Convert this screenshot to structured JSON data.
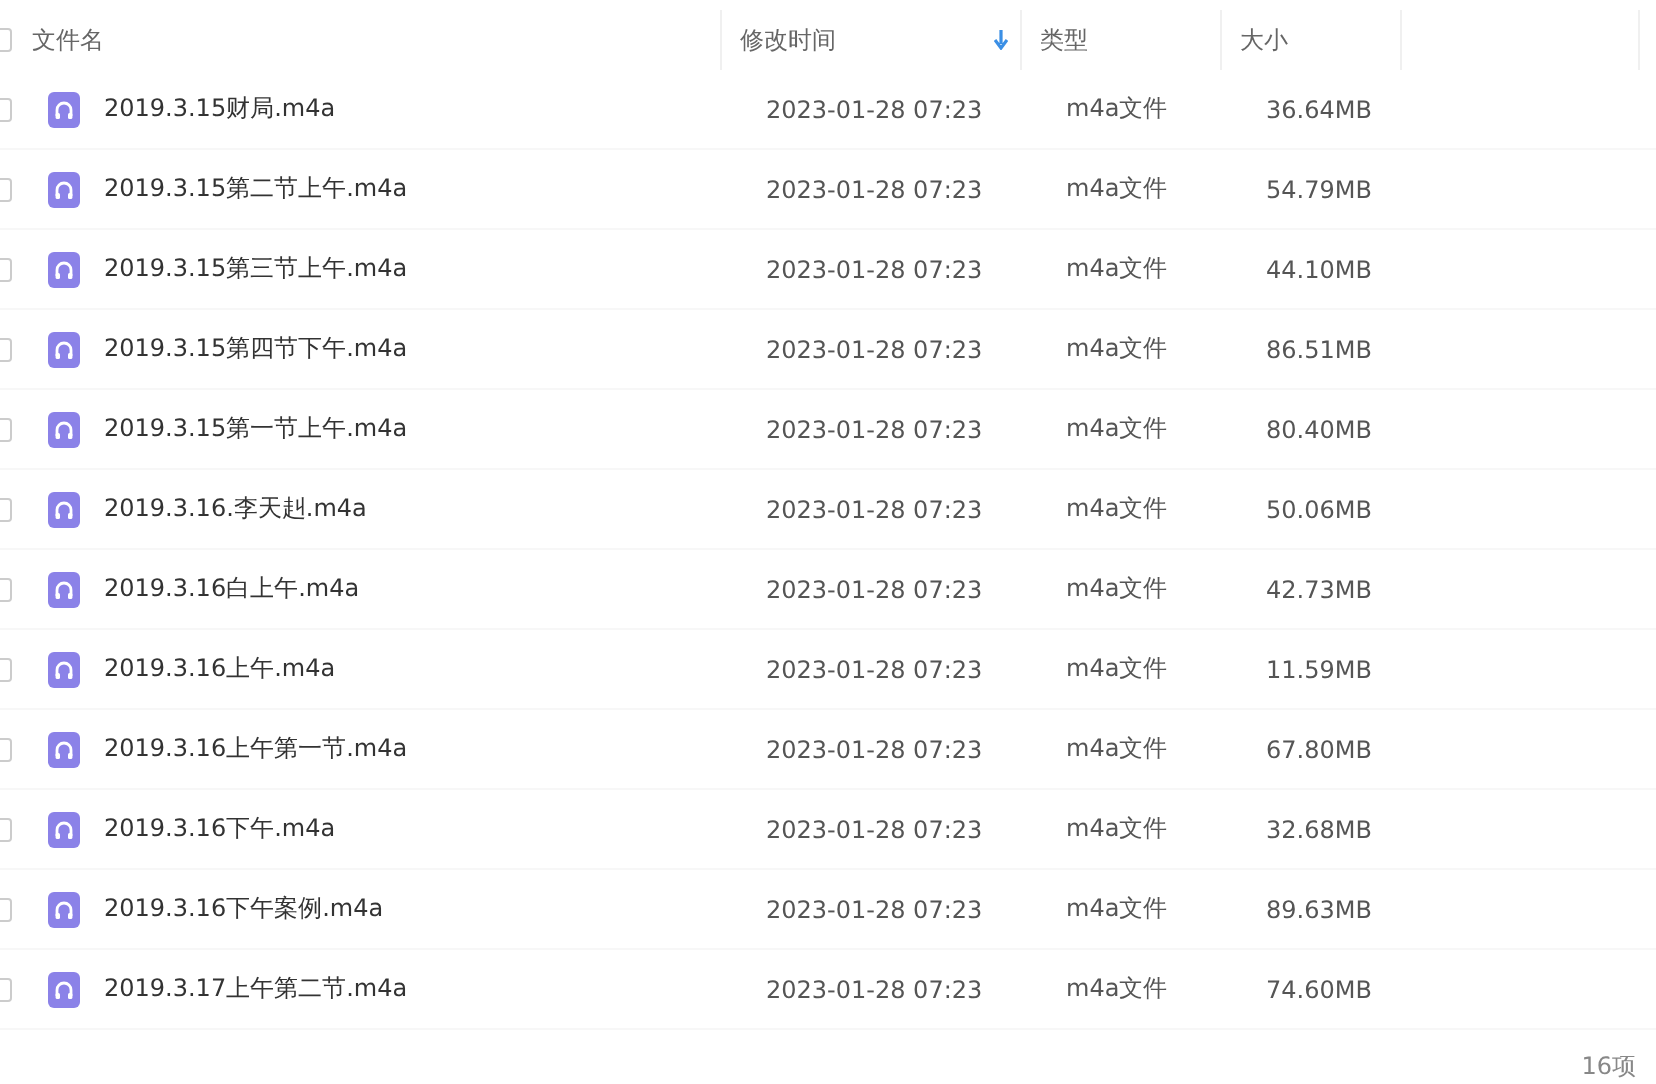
{
  "select_all_checked": false,
  "columns": [
    {
      "label": "文件名",
      "sorted": false
    },
    {
      "label": "修改时间",
      "sorted": true
    },
    {
      "label": "类型",
      "sorted": false
    },
    {
      "label": "大小",
      "sorted": false
    }
  ],
  "rows": [
    {
      "checked": false,
      "name": "2019.3.15财局.m4a",
      "modified": "2023-01-28 07:23",
      "type": "m4a文件",
      "size": "36.64MB"
    },
    {
      "checked": false,
      "name": "2019.3.15第二节上午.m4a",
      "modified": "2023-01-28 07:23",
      "type": "m4a文件",
      "size": "54.79MB"
    },
    {
      "checked": false,
      "name": "2019.3.15第三节上午.m4a",
      "modified": "2023-01-28 07:23",
      "type": "m4a文件",
      "size": "44.10MB"
    },
    {
      "checked": false,
      "name": "2019.3.15第四节下午.m4a",
      "modified": "2023-01-28 07:23",
      "type": "m4a文件",
      "size": "86.51MB"
    },
    {
      "checked": false,
      "name": "2019.3.15第一节上午.m4a",
      "modified": "2023-01-28 07:23",
      "type": "m4a文件",
      "size": "80.40MB"
    },
    {
      "checked": false,
      "name": "2019.3.16.李天赳.m4a",
      "modified": "2023-01-28 07:23",
      "type": "m4a文件",
      "size": "50.06MB"
    },
    {
      "checked": false,
      "name": "2019.3.16白上午.m4a",
      "modified": "2023-01-28 07:23",
      "type": "m4a文件",
      "size": "42.73MB"
    },
    {
      "checked": false,
      "name": "2019.3.16上午.m4a",
      "modified": "2023-01-28 07:23",
      "type": "m4a文件",
      "size": "11.59MB"
    },
    {
      "checked": false,
      "name": "2019.3.16上午第一节.m4a",
      "modified": "2023-01-28 07:23",
      "type": "m4a文件",
      "size": "67.80MB"
    },
    {
      "checked": false,
      "name": "2019.3.16下午.m4a",
      "modified": "2023-01-28 07:23",
      "type": "m4a文件",
      "size": "32.68MB"
    },
    {
      "checked": false,
      "name": "2019.3.16下午案例.m4a",
      "modified": "2023-01-28 07:23",
      "type": "m4a文件",
      "size": "89.63MB"
    },
    {
      "checked": false,
      "name": "2019.3.17上午第二节.m4a",
      "modified": "2023-01-28 07:23",
      "type": "m4a文件",
      "size": "74.60MB"
    }
  ],
  "item_count": "16项"
}
